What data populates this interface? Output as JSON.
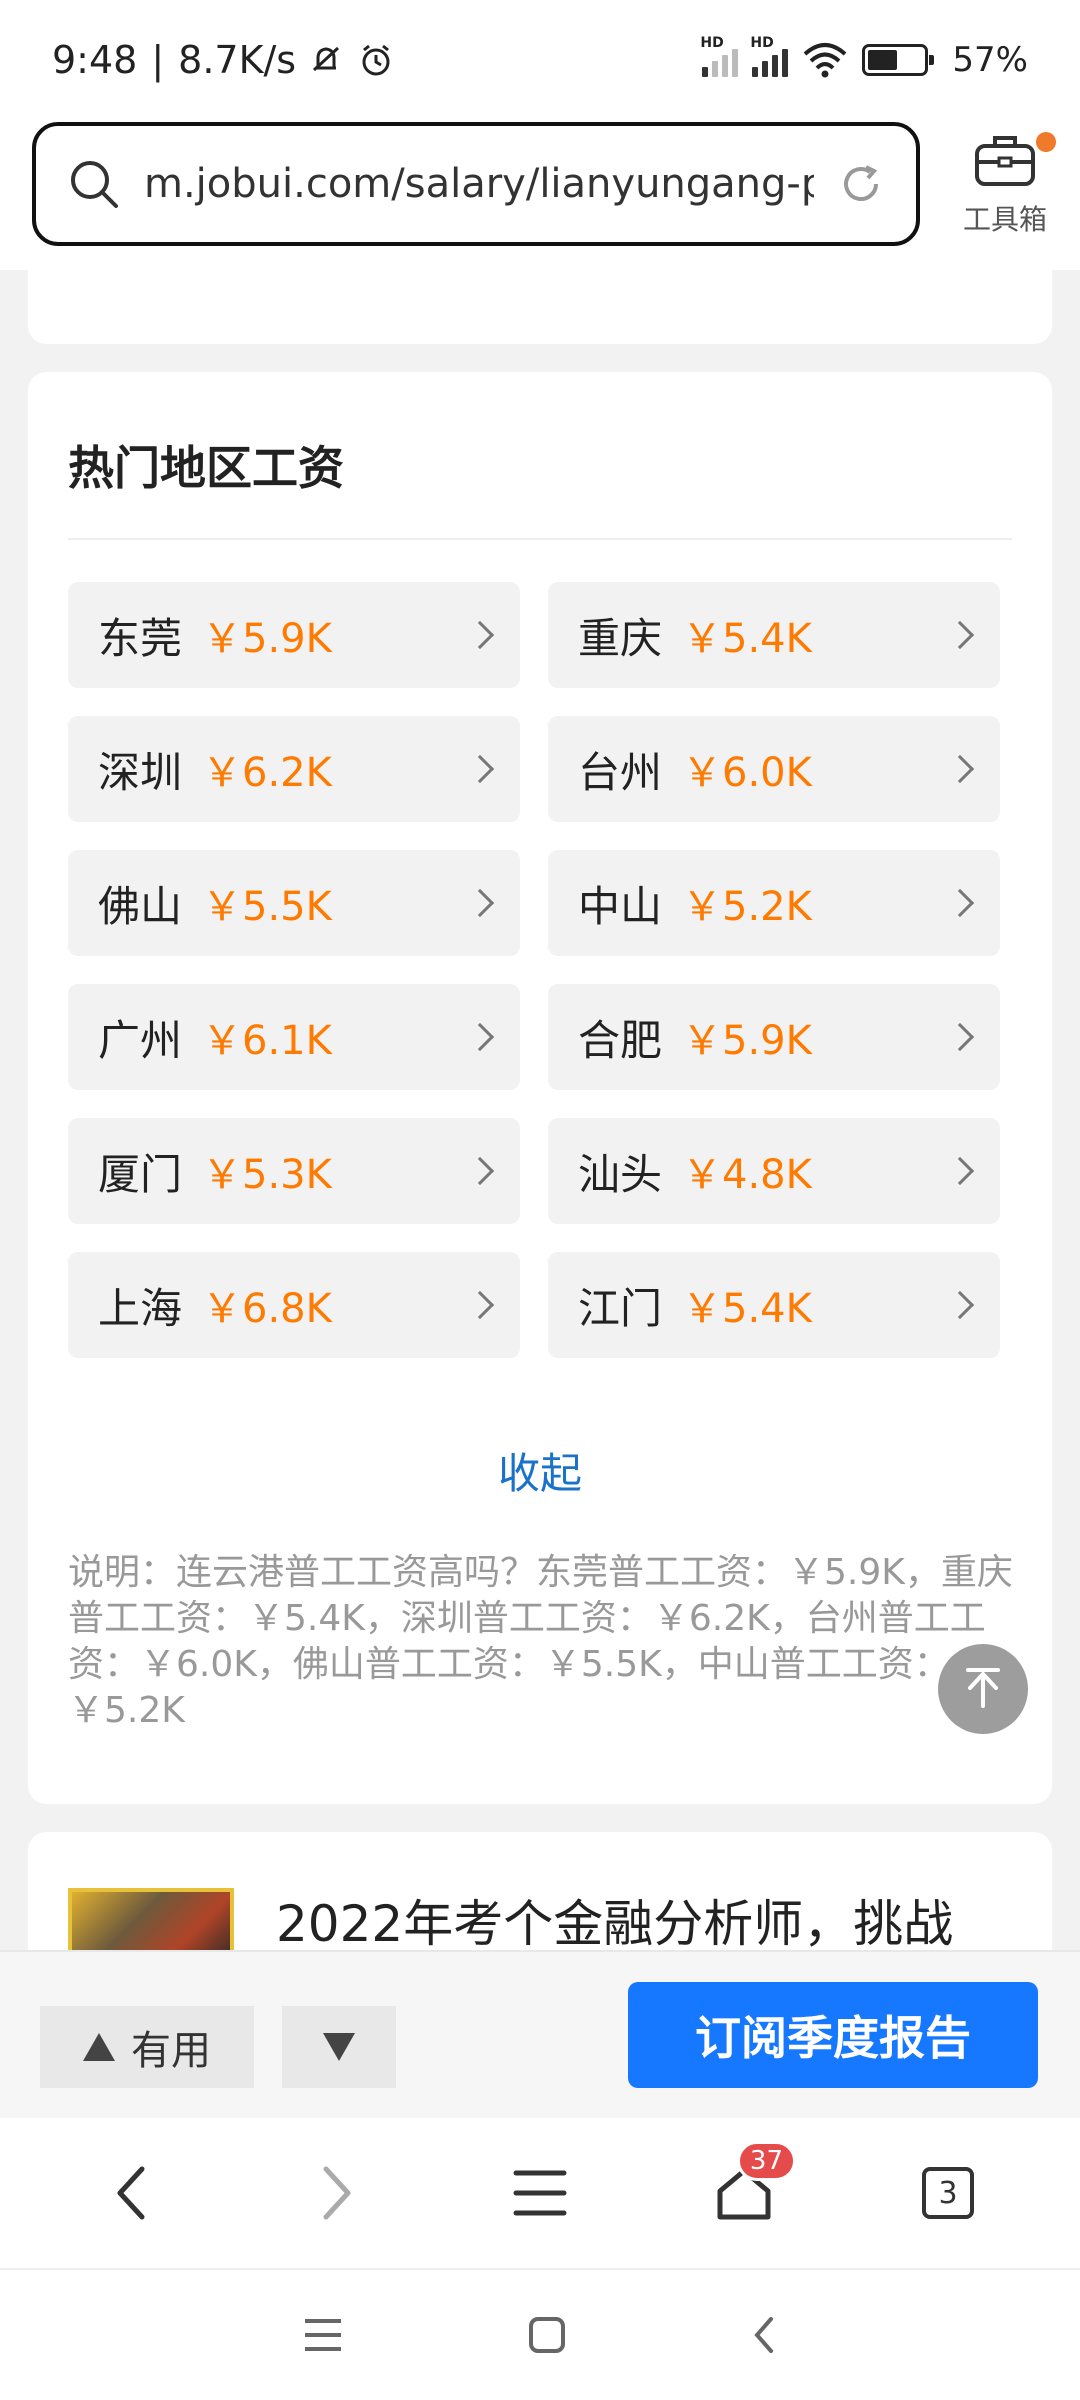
{
  "status_bar": {
    "time": "9:48",
    "speed": "8.7K/s",
    "battery_pct": "57%"
  },
  "browser": {
    "url": "m.jobui.com/salary/lianyungang-p...",
    "toolbox_label": "工具箱"
  },
  "section": {
    "title": "热门地区工资",
    "items": [
      {
        "city": "东莞",
        "salary": "￥5.9K"
      },
      {
        "city": "重庆",
        "salary": "￥5.4K"
      },
      {
        "city": "深圳",
        "salary": "￥6.2K"
      },
      {
        "city": "台州",
        "salary": "￥6.0K"
      },
      {
        "city": "佛山",
        "salary": "￥5.5K"
      },
      {
        "city": "中山",
        "salary": "￥5.2K"
      },
      {
        "city": "广州",
        "salary": "￥6.1K"
      },
      {
        "city": "合肥",
        "salary": "￥5.9K"
      },
      {
        "city": "厦门",
        "salary": "￥5.3K"
      },
      {
        "city": "汕头",
        "salary": "￥4.8K"
      },
      {
        "city": "上海",
        "salary": "￥6.8K"
      },
      {
        "city": "江门",
        "salary": "￥5.4K"
      }
    ],
    "collapse_label": "收起",
    "note": "说明：连云港普工工资高吗？东莞普工工资：￥5.9K，重庆普工工资：￥5.4K，深圳普工工资：￥6.2K，台州普工工资：￥6.0K，佛山普工工资：￥5.5K，中山普工工资：￥5.2K"
  },
  "news": {
    "title": "2022年考个金融分析师，挑战"
  },
  "feedback": {
    "useful_label": "有用",
    "subscribe_label": "订阅季度报告"
  },
  "browser_nav": {
    "home_badge": "37",
    "tabs_count": "3"
  },
  "colors": {
    "salary": "#ff7a00",
    "link": "#1a73c8",
    "primary_button": "#1677ff",
    "badge": "#e54b4b",
    "toolbox_dot": "#f07a2a"
  },
  "icons": [
    "search-icon",
    "refresh-icon",
    "toolbox-icon",
    "chevron-right-icon",
    "back-to-top-icon",
    "triangle-up-icon",
    "triangle-down-icon",
    "back-icon",
    "forward-icon",
    "menu-icon",
    "home-icon",
    "tabs-icon"
  ]
}
